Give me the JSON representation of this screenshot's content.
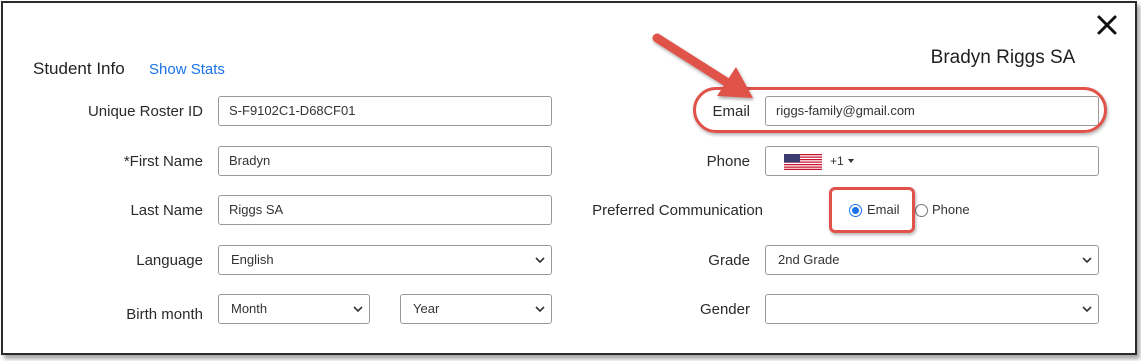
{
  "student_name": "Bradyn Riggs SA",
  "section_title": "Student Info",
  "show_stats_label": "Show Stats",
  "left": {
    "roster_label": "Unique Roster ID",
    "roster_value": "S-F9102C1-D68CF01",
    "first_name_label": "*First Name",
    "first_name_value": "Bradyn",
    "last_name_label": "Last Name",
    "last_name_value": "Riggs SA",
    "language_label": "Language",
    "language_value": "English",
    "birth_label": "Birth month",
    "birth_month_value": "Month",
    "birth_year_value": "Year"
  },
  "right": {
    "email_label": "Email",
    "email_value": "riggs-family@gmail.com",
    "phone_label": "Phone",
    "phone_prefix": "+1",
    "phone_value": "",
    "pref_label": "Preferred Communication",
    "pref_email": "Email",
    "pref_phone": "Phone",
    "grade_label": "Grade",
    "grade_value": "2nd Grade",
    "gender_label": "Gender",
    "gender_value": ""
  },
  "colors": {
    "accent": "#1a73e8",
    "highlight": "#e0524a"
  },
  "icons": [
    "close-icon",
    "us-flag-icon",
    "chevron-down-icon",
    "annotation-arrow"
  ]
}
